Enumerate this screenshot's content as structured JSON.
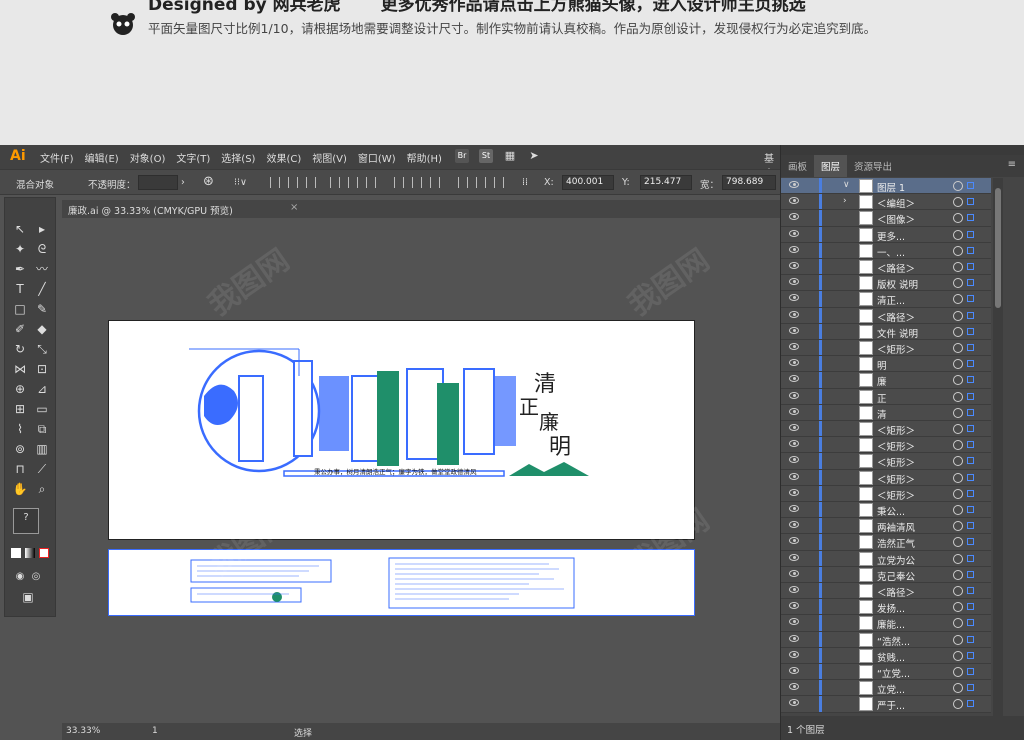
{
  "banner": {
    "headline_left": "Designed by 网兵老虎",
    "headline_right": "更多优秀作品请点击上方熊猫头像，进入设计师主页挑选",
    "notice": "平面矢量图尺寸比例1/10，请根据场地需要调整设计尺寸。制作实物前请认真校稿。作品为原创设计，发现侵权行为必定追究到底。"
  },
  "app": {
    "logo": "Ai",
    "menus": [
      "文件(F)",
      "编辑(E)",
      "对象(O)",
      "文字(T)",
      "选择(S)",
      "效果(C)",
      "视图(V)",
      "窗口(W)",
      "帮助(H)"
    ],
    "bridge_icon": "Br",
    "stock_icon": "St",
    "workspace": "基本"
  },
  "control_bar": {
    "selection_label": "混合对象",
    "opacity_label": "不透明度：",
    "x_label": "X:",
    "x_value": "400.001",
    "y_label": "Y:",
    "y_value": "215.477",
    "w_label": "宽：",
    "w_value": "798.689"
  },
  "document_tab": {
    "title": "廉政.ai @ 33.33% (CMYK/GPU 预览)",
    "close": "×"
  },
  "status_bar": {
    "zoom": "33.33%",
    "page": "1",
    "mode": "选择"
  },
  "panel": {
    "tabs": [
      "画板",
      "图层",
      "资源导出"
    ],
    "active_tab": "图层",
    "layer_count": "1 个图层",
    "layers": [
      {
        "name": "图层 1",
        "expand": "∨",
        "top": true
      },
      {
        "name": "＜编组＞",
        "expand": "›"
      },
      {
        "name": "＜图像＞"
      },
      {
        "name": "更多..."
      },
      {
        "name": "一、..."
      },
      {
        "name": "＜路径＞"
      },
      {
        "name": "版权 说明"
      },
      {
        "name": "清正..."
      },
      {
        "name": "＜路径＞"
      },
      {
        "name": "文件 说明"
      },
      {
        "name": "＜矩形＞"
      },
      {
        "name": "明"
      },
      {
        "name": "廉"
      },
      {
        "name": "正"
      },
      {
        "name": "清"
      },
      {
        "name": "＜矩形＞"
      },
      {
        "name": "＜矩形＞"
      },
      {
        "name": "＜矩形＞"
      },
      {
        "name": "＜矩形＞"
      },
      {
        "name": "＜矩形＞"
      },
      {
        "name": "秉公..."
      },
      {
        "name": "两袖清风"
      },
      {
        "name": "浩然正气"
      },
      {
        "name": "立党为公"
      },
      {
        "name": "克己奉公"
      },
      {
        "name": "＜路径＞"
      },
      {
        "name": "发扬..."
      },
      {
        "name": "廉能..."
      },
      {
        "name": "“浩然..."
      },
      {
        "name": "贫贱..."
      },
      {
        "name": "“立党..."
      },
      {
        "name": "立党..."
      },
      {
        "name": "严于..."
      }
    ]
  },
  "artwork": {
    "title_chars": [
      "清",
      "正",
      "廉",
      "明"
    ],
    "slogan": "秉公办事，树月清朗浩正气；廉字为铁，做堂堂政德清风"
  },
  "watermark": "我图网",
  "colors": {
    "accent_blue": "#3a6cff",
    "panel_bg": "#454545",
    "canvas_bg": "#535353",
    "ai_orange": "#ff9a00"
  }
}
